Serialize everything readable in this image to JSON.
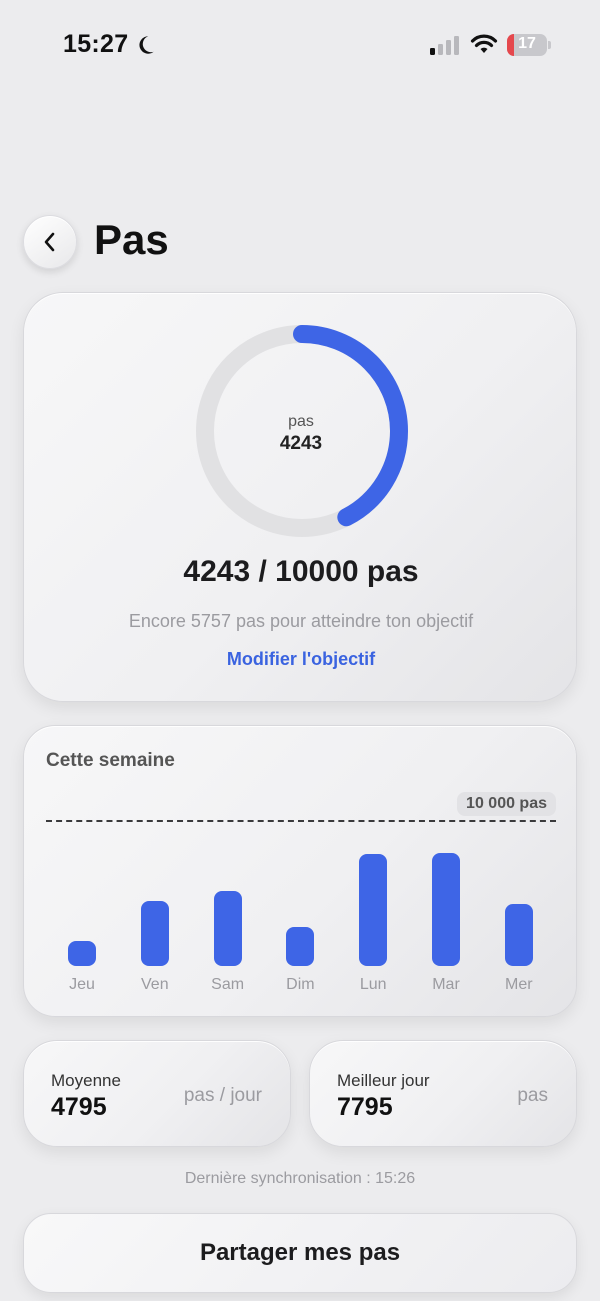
{
  "status_bar": {
    "time": "15:27",
    "battery": "17",
    "battery_level": 0.17,
    "focus_icon": "moon-icon",
    "signal_icon": "cellular-signal-icon",
    "wifi_icon": "wifi-icon"
  },
  "header": {
    "title": "Pas",
    "back_icon": "chevron-left-icon"
  },
  "goal": {
    "ring_label": "pas",
    "ring_value": "4243",
    "progress": 0.4243,
    "summary": "4243 / 10000 pas",
    "remaining": "Encore 5757 pas pour atteindre ton objectif",
    "edit_label": "Modifier l'objectif"
  },
  "week": {
    "title": "Cette semaine",
    "goal_label": "10 000 pas"
  },
  "stats": {
    "average": {
      "label": "Moyenne",
      "value": "4795",
      "unit": "pas / jour"
    },
    "best": {
      "label": "Meilleur jour",
      "value": "7795",
      "unit": "pas"
    }
  },
  "sync_text": "Dernière synchronisation : 15:26",
  "share_label": "Partager mes pas",
  "colors": {
    "accent": "#3e65e6",
    "ring_track": "#e1e1e3",
    "battery_low": "#e5484d"
  },
  "chart_data": {
    "type": "bar",
    "categories": [
      "Jeu",
      "Ven",
      "Sam",
      "Dim",
      "Lun",
      "Mar",
      "Mer"
    ],
    "values": [
      1700,
      4500,
      5200,
      2700,
      7700,
      7795,
      4243
    ],
    "goal": 10000,
    "goal_label": "10 000 pas",
    "ylim": [
      0,
      10000
    ],
    "grid": false
  }
}
